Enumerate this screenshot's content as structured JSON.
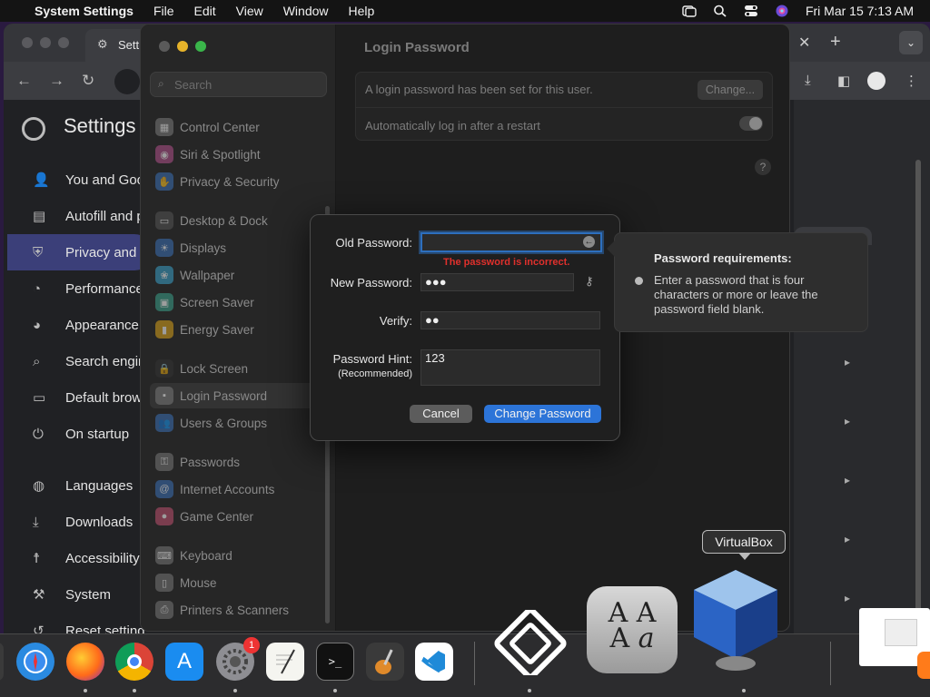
{
  "menubar": {
    "app_name": "System Settings",
    "menus": [
      "File",
      "Edit",
      "View",
      "Window",
      "Help"
    ],
    "clock": "Fri Mar 15  7:13 AM"
  },
  "chrome": {
    "tab_label": "Settings",
    "title": "Settings",
    "sidebar": [
      {
        "label": "You and Goog",
        "icon": "person-icon"
      },
      {
        "label": "Autofill and p",
        "icon": "clipboard-icon"
      },
      {
        "label": "Privacy and s",
        "icon": "shield-icon"
      },
      {
        "label": "Performance",
        "icon": "gauge-icon"
      },
      {
        "label": "Appearance",
        "icon": "palette-icon"
      },
      {
        "label": "Search engin",
        "icon": "search-icon"
      },
      {
        "label": "Default brow",
        "icon": "browser-icon"
      },
      {
        "label": "On startup",
        "icon": "power-icon"
      },
      {
        "label": "Languages",
        "icon": "globe-icon"
      },
      {
        "label": "Downloads",
        "icon": "download-icon"
      },
      {
        "label": "Accessibility",
        "icon": "accessibility-icon"
      },
      {
        "label": "System",
        "icon": "wrench-icon"
      },
      {
        "label": "Reset setting",
        "icon": "reset-icon"
      }
    ]
  },
  "settings": {
    "search_placeholder": "Search",
    "sidebar": [
      {
        "label": "Control Center",
        "icon": "control-center-icon",
        "color": "#7a7a7a"
      },
      {
        "label": "Siri & Spotlight",
        "icon": "siri-icon",
        "color": "#b0508a"
      },
      {
        "label": "Privacy & Security",
        "icon": "hand-icon",
        "color": "#3a6fb5"
      },
      {
        "label": "Desktop & Dock",
        "icon": "dock-icon",
        "color": "#555555"
      },
      {
        "label": "Displays",
        "icon": "sun-icon",
        "color": "#3a6fb5"
      },
      {
        "label": "Wallpaper",
        "icon": "wallpaper-icon",
        "color": "#3aa0c8"
      },
      {
        "label": "Screen Saver",
        "icon": "screensaver-icon",
        "color": "#3aa08a"
      },
      {
        "label": "Energy Saver",
        "icon": "battery-icon",
        "color": "#d9a21b"
      },
      {
        "label": "Lock Screen",
        "icon": "lock-icon",
        "color": "#333333"
      },
      {
        "label": "Login Password",
        "icon": "password-icon",
        "color": "#777777"
      },
      {
        "label": "Users & Groups",
        "icon": "users-icon",
        "color": "#3a6fb5"
      },
      {
        "label": "Passwords",
        "icon": "key-icon",
        "color": "#777777"
      },
      {
        "label": "Internet Accounts",
        "icon": "at-icon",
        "color": "#3a6fb5"
      },
      {
        "label": "Game Center",
        "icon": "game-center-icon",
        "color": "#c05070"
      },
      {
        "label": "Keyboard",
        "icon": "keyboard-icon",
        "color": "#777777"
      },
      {
        "label": "Mouse",
        "icon": "mouse-icon",
        "color": "#777777"
      },
      {
        "label": "Printers & Scanners",
        "icon": "printer-icon",
        "color": "#777777"
      }
    ],
    "page_title": "Login Password",
    "password_set_text": "A login password has been set for this user.",
    "change_label": "Change...",
    "auto_login_text": "Automatically log in after a restart",
    "help_label": "?"
  },
  "dialog": {
    "old_label": "Old Password:",
    "old_value": "",
    "error": "The password is incorrect.",
    "new_label": "New Password:",
    "new_value": "●●●",
    "verify_label": "Verify:",
    "verify_value": "●●",
    "hint_label": "Password Hint:",
    "hint_sublabel": "(Recommended)",
    "hint_value": "123",
    "cancel_label": "Cancel",
    "submit_label": "Change Password"
  },
  "requirements": {
    "title": "Password requirements:",
    "text": "Enter a password that is four characters or more or leave the password field blank."
  },
  "dock": {
    "tooltip": "VirtualBox",
    "badge": "1",
    "apps": [
      "Safari",
      "Firefox",
      "Chrome",
      "App Store",
      "System Settings",
      "TextEdit",
      "Terminal",
      "GarageBand",
      "VS Code",
      "VirtualBox"
    ]
  },
  "colors": {
    "accent": "#2c74d8",
    "error": "#e0302c"
  }
}
